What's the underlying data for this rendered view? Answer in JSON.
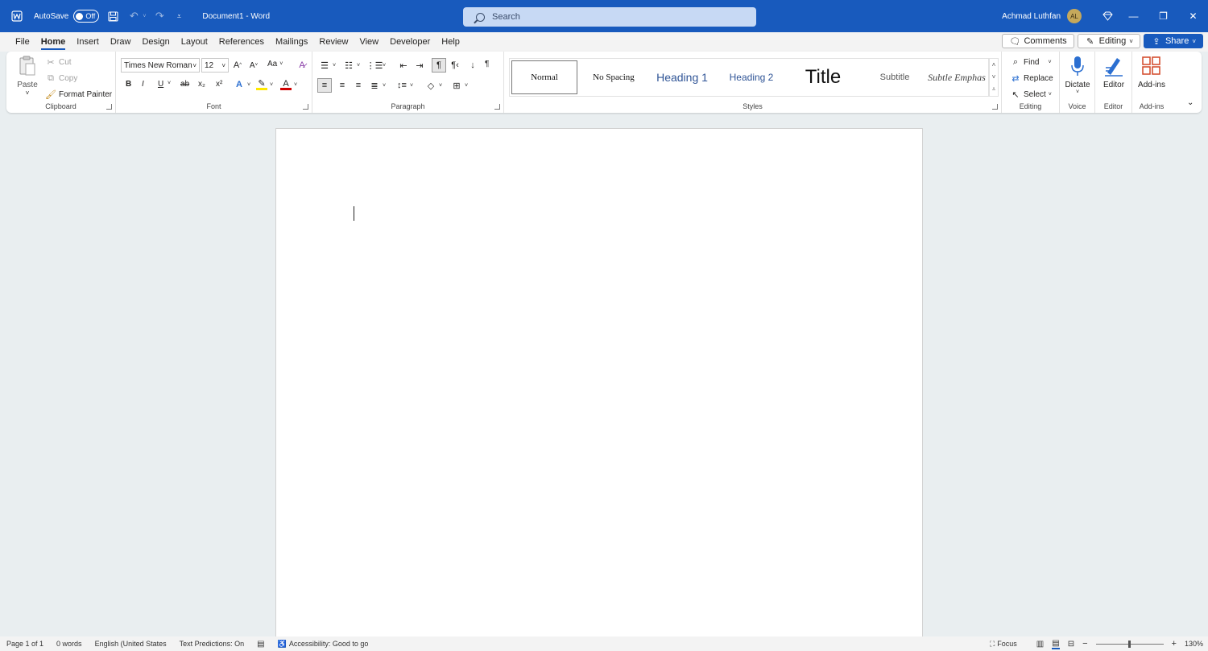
{
  "titlebar": {
    "autosave_label": "AutoSave",
    "autosave_state": "Off",
    "doc_title": "Document1  -  Word",
    "search_placeholder": "Search",
    "user_name": "Achmad Luthfan",
    "user_initials": "AL"
  },
  "menu": {
    "tabs": [
      "File",
      "Home",
      "Insert",
      "Draw",
      "Design",
      "Layout",
      "References",
      "Mailings",
      "Review",
      "View",
      "Developer",
      "Help"
    ],
    "active_tab": "Home",
    "comments_label": "Comments",
    "editing_label": "Editing",
    "share_label": "Share"
  },
  "ribbon": {
    "clipboard": {
      "label": "Clipboard",
      "paste": "Paste",
      "cut": "Cut",
      "copy": "Copy",
      "format_painter": "Format Painter"
    },
    "font": {
      "label": "Font",
      "font_name": "Times New Roman",
      "font_size": "12",
      "change_case": "Aa",
      "bold": "B",
      "italic": "I",
      "underline": "U",
      "strike": "ab",
      "sub": "x₂",
      "sup": "x²",
      "grow": "A^",
      "shrink": "A˅"
    },
    "paragraph": {
      "label": "Paragraph",
      "pilcrow": "¶"
    },
    "styles": {
      "label": "Styles",
      "items": [
        "Normal",
        "No Spacing",
        "Heading 1",
        "Heading 2",
        "Title",
        "Subtitle",
        "Subtle Emphas"
      ]
    },
    "editing": {
      "label": "Editing",
      "find": "Find",
      "replace": "Replace",
      "select": "Select"
    },
    "voice": {
      "label": "Voice",
      "dictate": "Dictate"
    },
    "editor": {
      "label": "Editor",
      "editor": "Editor"
    },
    "addins": {
      "label": "Add-ins",
      "addins": "Add-ins"
    }
  },
  "statusbar": {
    "page": "Page 1 of 1",
    "words": "0 words",
    "language": "English (United States",
    "text_predictions": "Text Predictions: On",
    "accessibility": "Accessibility: Good to go",
    "focus": "Focus",
    "zoom_minus": "−",
    "zoom_plus": "+",
    "zoom_level": "130%"
  },
  "colors": {
    "brand": "#185abd",
    "ribbon_bg": "#ffffff",
    "canvas_bg": "#e9eef0"
  }
}
